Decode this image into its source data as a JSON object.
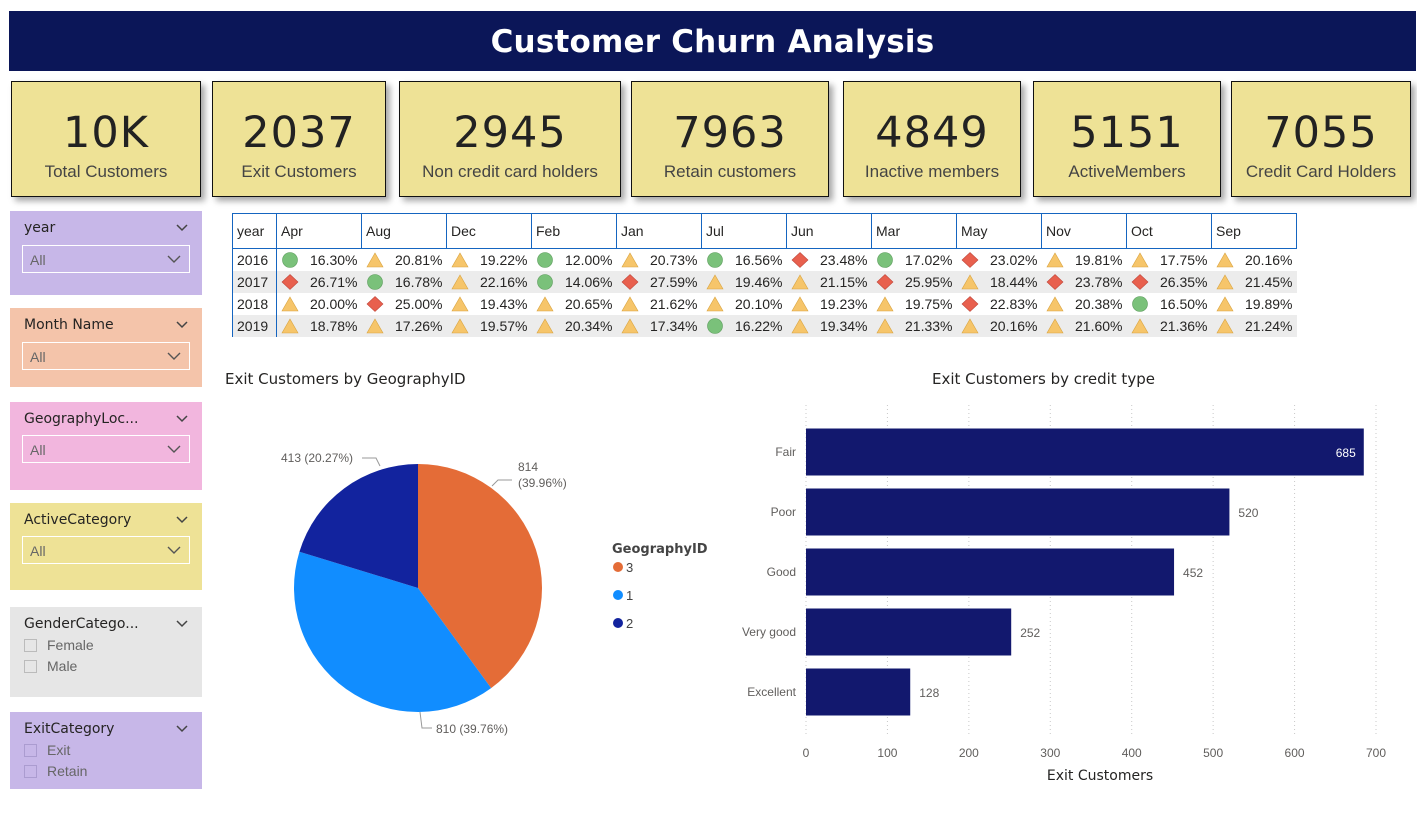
{
  "title": "Customer Churn Analysis",
  "kpis": [
    {
      "value": "10K",
      "label": "Total Customers"
    },
    {
      "value": "2037",
      "label": "Exit Customers"
    },
    {
      "value": "2945",
      "label": "Non credit card holders"
    },
    {
      "value": "7963",
      "label": "Retain customers"
    },
    {
      "value": "4849",
      "label": "Inactive members"
    },
    {
      "value": "5151",
      "label": "ActiveMembers"
    },
    {
      "value": "7055",
      "label": "Credit Card Holders"
    }
  ],
  "slicers": {
    "year": {
      "title": "year",
      "value": "All",
      "color": "#c7b7e8"
    },
    "month": {
      "title": "Month Name",
      "value": "All",
      "color": "#f4c4aa"
    },
    "geo": {
      "title": "GeographyLoc...",
      "value": "All",
      "color": "#f2b6de"
    },
    "active": {
      "title": "ActiveCategory",
      "value": "All",
      "color": "#eee296"
    },
    "gender": {
      "title": "GenderCatego...",
      "options": [
        "Female",
        "Male"
      ],
      "color": "#e6e6e6"
    },
    "exit": {
      "title": "ExitCategory",
      "options": [
        "Exit",
        "Retain"
      ],
      "color": "#c7b7e8"
    }
  },
  "matrix": {
    "corner": "year",
    "columns": [
      "Apr",
      "Aug",
      "Dec",
      "Feb",
      "Jan",
      "Jul",
      "Jun",
      "Mar",
      "May",
      "Nov",
      "Oct",
      "Sep"
    ],
    "rows": [
      {
        "year": "2016",
        "cells": [
          [
            "16.30%",
            "circle"
          ],
          [
            "20.81%",
            "triangle"
          ],
          [
            "19.22%",
            "triangle"
          ],
          [
            "12.00%",
            "circle"
          ],
          [
            "20.73%",
            "triangle"
          ],
          [
            "16.56%",
            "circle"
          ],
          [
            "23.48%",
            "diamond"
          ],
          [
            "17.02%",
            "circle"
          ],
          [
            "23.02%",
            "diamond"
          ],
          [
            "19.81%",
            "triangle"
          ],
          [
            "17.75%",
            "triangle"
          ],
          [
            "20.16%",
            "triangle"
          ]
        ]
      },
      {
        "year": "2017",
        "cells": [
          [
            "26.71%",
            "diamond"
          ],
          [
            "16.78%",
            "circle"
          ],
          [
            "22.16%",
            "triangle"
          ],
          [
            "14.06%",
            "circle"
          ],
          [
            "27.59%",
            "diamond"
          ],
          [
            "19.46%",
            "triangle"
          ],
          [
            "21.15%",
            "triangle"
          ],
          [
            "25.95%",
            "diamond"
          ],
          [
            "18.44%",
            "triangle"
          ],
          [
            "23.78%",
            "diamond"
          ],
          [
            "26.35%",
            "diamond"
          ],
          [
            "21.45%",
            "triangle"
          ]
        ]
      },
      {
        "year": "2018",
        "cells": [
          [
            "20.00%",
            "triangle"
          ],
          [
            "25.00%",
            "diamond"
          ],
          [
            "19.43%",
            "triangle"
          ],
          [
            "20.65%",
            "triangle"
          ],
          [
            "21.62%",
            "triangle"
          ],
          [
            "20.10%",
            "triangle"
          ],
          [
            "19.23%",
            "triangle"
          ],
          [
            "19.75%",
            "triangle"
          ],
          [
            "22.83%",
            "diamond"
          ],
          [
            "20.38%",
            "triangle"
          ],
          [
            "16.50%",
            "circle"
          ],
          [
            "19.89%",
            "triangle"
          ]
        ]
      },
      {
        "year": "2019",
        "cells": [
          [
            "18.78%",
            "triangle"
          ],
          [
            "17.26%",
            "triangle"
          ],
          [
            "19.57%",
            "triangle"
          ],
          [
            "20.34%",
            "triangle"
          ],
          [
            "17.34%",
            "triangle"
          ],
          [
            "16.22%",
            "circle"
          ],
          [
            "19.34%",
            "triangle"
          ],
          [
            "21.33%",
            "triangle"
          ],
          [
            "20.16%",
            "triangle"
          ],
          [
            "21.60%",
            "triangle"
          ],
          [
            "21.36%",
            "triangle"
          ],
          [
            "21.24%",
            "triangle"
          ]
        ]
      }
    ],
    "icon_colors": {
      "circle": "#7ac17a",
      "triangle": "#f6c56a",
      "diamond": "#e8604e"
    }
  },
  "chart_data": [
    {
      "type": "pie",
      "title": "Exit Customers by GeographyID",
      "legend_title": "GeographyID",
      "legend_position": "right",
      "slices": [
        {
          "name": "3",
          "value": 814,
          "label": "814 (39.96%)",
          "color": "#e46c37"
        },
        {
          "name": "1",
          "value": 810,
          "label": "810 (39.76%)",
          "color": "#118dff"
        },
        {
          "name": "2",
          "value": 413,
          "label": "413 (20.27%)",
          "color": "#12239e"
        }
      ]
    },
    {
      "type": "bar",
      "orientation": "horizontal",
      "title": "Exit Customers by credit type",
      "xlabel": "Exit Customers",
      "ylabel": "",
      "categories": [
        "Fair",
        "Poor",
        "Good",
        "Very good",
        "Excellent"
      ],
      "values": [
        685,
        520,
        452,
        252,
        128
      ],
      "xlim": [
        0,
        700
      ],
      "xticks": [
        0,
        100,
        200,
        300,
        400,
        500,
        600,
        700
      ],
      "grid": true,
      "bar_color": "#12186e"
    }
  ]
}
